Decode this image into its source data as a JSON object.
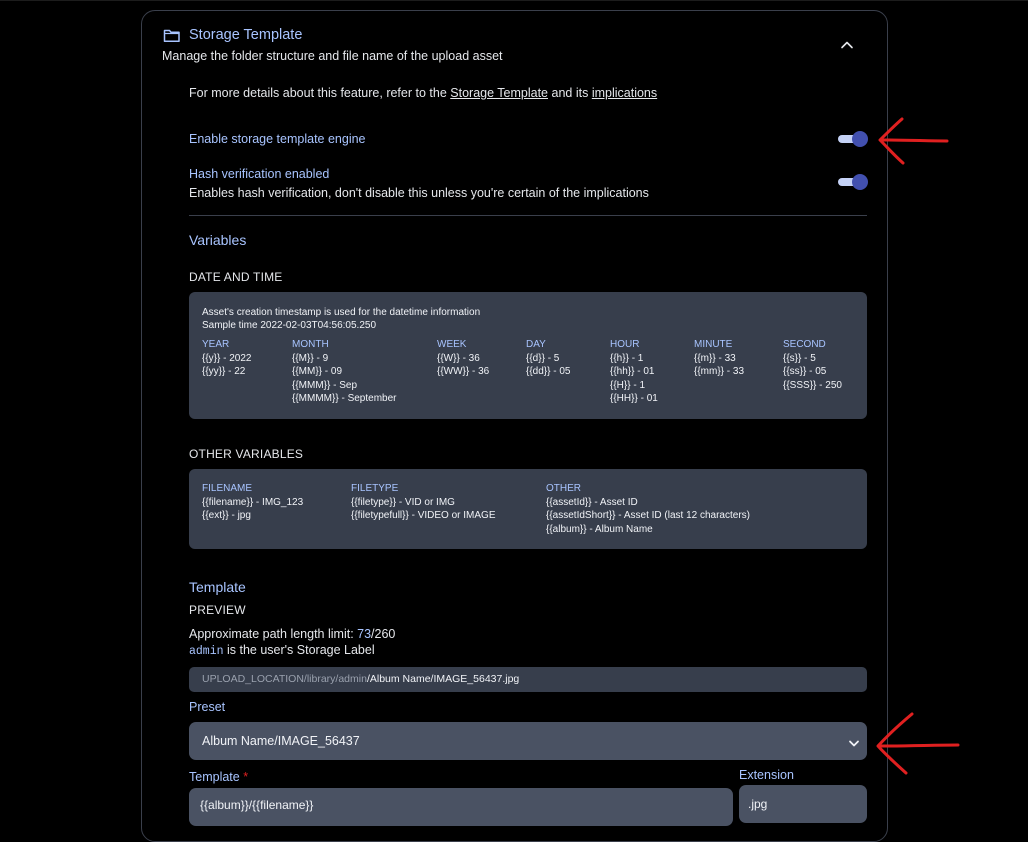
{
  "header": {
    "title": "Storage Template",
    "subtitle": "Manage the folder structure and file name of the upload asset"
  },
  "details": {
    "prefix": "For more details about this feature, refer to the",
    "link1": "Storage Template",
    "middle": "and its",
    "link2": "implications"
  },
  "settings": {
    "engine_label": "Enable storage template engine",
    "engine_enabled": true,
    "hash_label": "Hash verification enabled",
    "hash_desc": "Enables hash verification, don't disable this unless you're certain of the implications",
    "hash_enabled": true
  },
  "variables": {
    "title": "Variables",
    "date_time_heading": "DATE AND TIME",
    "datetime_info": "Asset's creation timestamp is used for the datetime information",
    "sample_time": "Sample time 2022-02-03T04:56:05.250",
    "date_columns": [
      {
        "name": "YEAR",
        "items": "{{y}} - 2022\n{{yy}} - 22"
      },
      {
        "name": "MONTH",
        "items": "{{M}} - 9\n{{MM}} - 09\n{{MMM}} - Sep\n{{MMMM}} - September"
      },
      {
        "name": "WEEK",
        "items": "{{W}} - 36\n{{WW}} - 36"
      },
      {
        "name": "DAY",
        "items": "{{d}} - 5\n{{dd}} - 05"
      },
      {
        "name": "HOUR",
        "items": "{{h}} - 1\n{{hh}} - 01\n{{H}} - 1\n{{HH}} - 01"
      },
      {
        "name": "MINUTE",
        "items": "{{m}} - 33\n{{mm}} - 33"
      },
      {
        "name": "SECOND",
        "items": "{{s}} - 5\n{{ss}} - 05\n{{SSS}} - 250"
      }
    ],
    "other_heading": "OTHER VARIABLES",
    "other_columns": [
      {
        "name": "FILENAME",
        "items": "{{filename}} - IMG_123\n{{ext}} - jpg"
      },
      {
        "name": "FILETYPE",
        "items": "{{filetype}} - VID or IMG\n{{filetypefull}} - VIDEO or IMAGE"
      },
      {
        "name": "OTHER",
        "items": "{{assetId}} - Asset ID\n{{assetIdShort}} - Asset ID (last 12 characters)\n{{album}} - Album Name"
      }
    ]
  },
  "template": {
    "title": "Template",
    "preview_heading": "PREVIEW",
    "path_limit_prefix": "Approximate path length limit: ",
    "path_limit_value": "73",
    "path_limit_max": "/260",
    "storage_label_name": "admin",
    "storage_label_suffix": " is the user's Storage Label",
    "preview_base": "UPLOAD_LOCATION/library/admin",
    "preview_rest": "/Album Name/IMAGE_56437.jpg",
    "preset_label": "Preset",
    "preset_value": "Album Name/IMAGE_56437",
    "template_label": "Template",
    "required_mark": "*",
    "template_value": "{{album}}/{{filename}}",
    "extension_label": "Extension",
    "extension_value": ".jpg"
  },
  "colors": {
    "accent": "#a8c4ff",
    "toggle_knob": "#4250af",
    "annotation_red": "#e02020"
  }
}
